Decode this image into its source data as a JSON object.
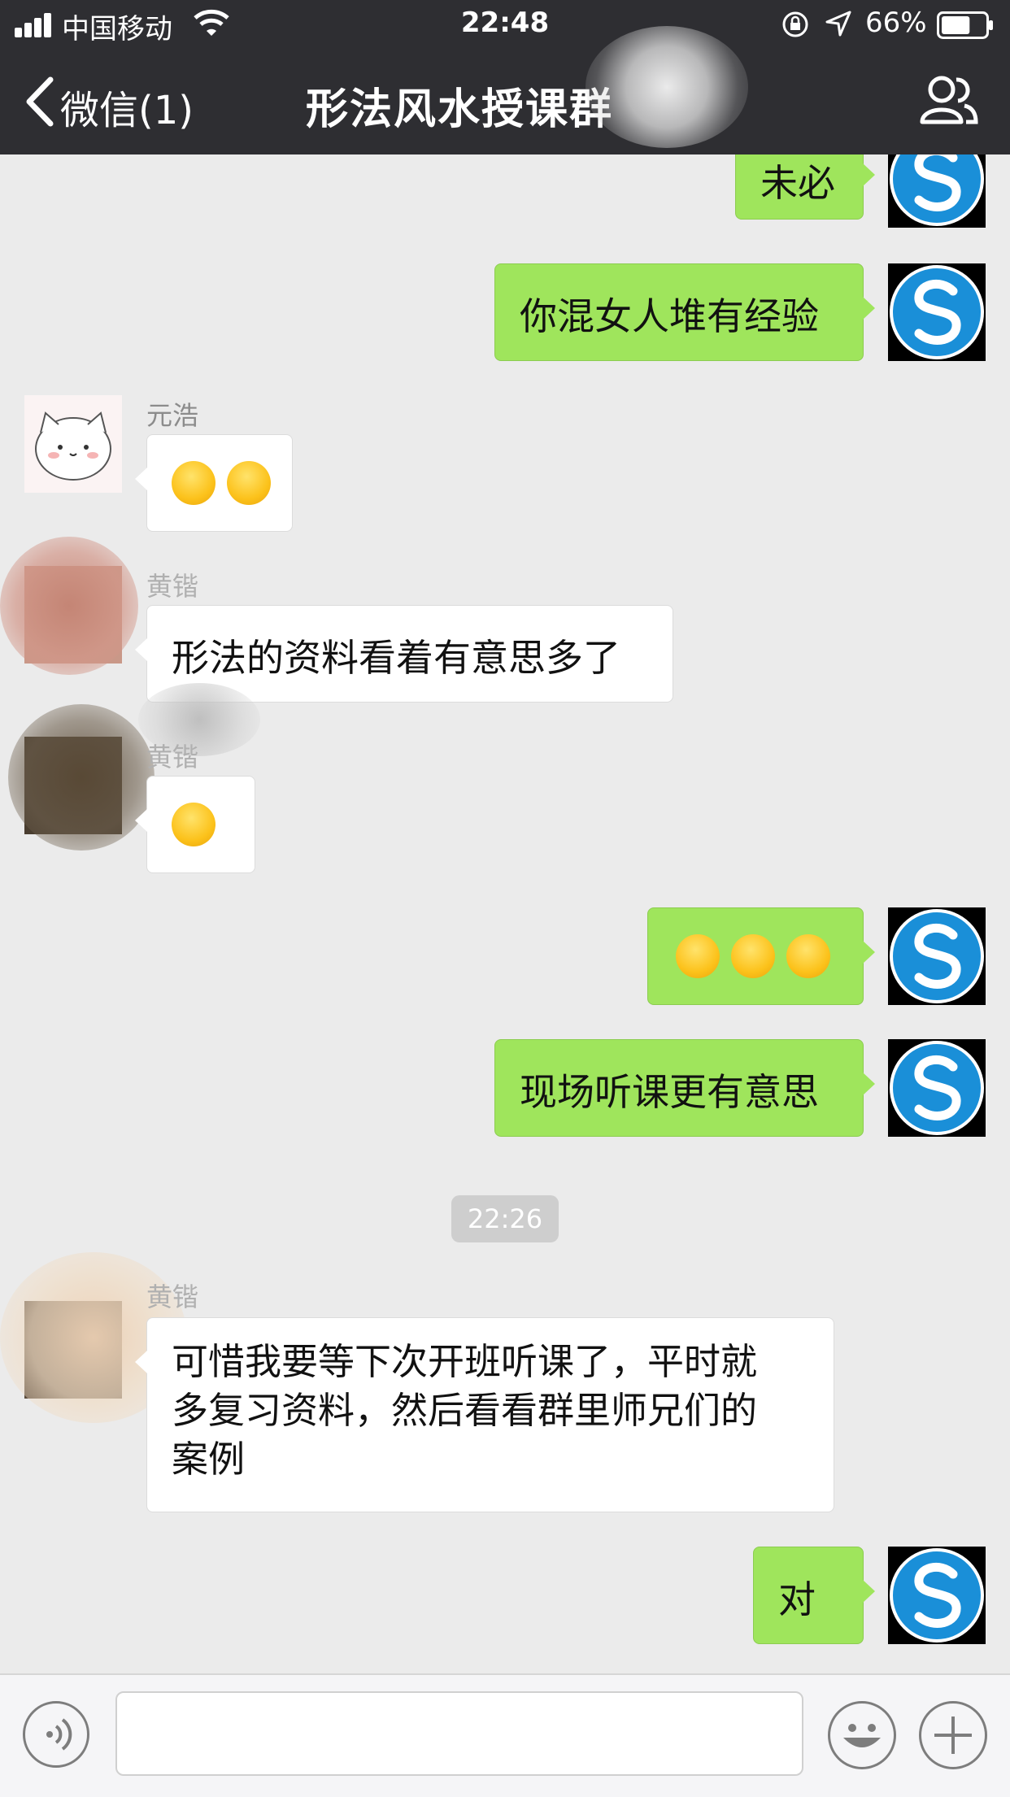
{
  "status_bar": {
    "carrier": "中国移动",
    "time": "22:48",
    "battery_percent": "66%",
    "battery_level": 0.66
  },
  "nav": {
    "back_label": "微信(1)",
    "title": "形法风水授课群"
  },
  "messages": [
    {
      "side": "out",
      "text": "未必"
    },
    {
      "side": "out",
      "text": "你混女人堆有经验"
    },
    {
      "side": "in",
      "sender": "元浩",
      "text": "😭😭"
    },
    {
      "side": "in",
      "sender": "黄锴",
      "text": "形法的资料看着有意思多了"
    },
    {
      "side": "in",
      "sender": "黄锴",
      "text": "🤭"
    },
    {
      "side": "out",
      "text": "😄😄😄"
    },
    {
      "side": "out",
      "text": "现场听课更有意思"
    },
    {
      "type": "timestamp",
      "text": "22:26"
    },
    {
      "side": "in",
      "sender": "黄锴",
      "lines": [
        "可惜我要等下次开班听课了，平时就",
        "多复习资料，然后看看群里师兄们的",
        "案例"
      ]
    },
    {
      "side": "out",
      "text": "对"
    }
  ],
  "input": {
    "placeholder": "",
    "value": ""
  },
  "colors": {
    "nav_bg": "#2e2e32",
    "chat_bg": "#ebebeb",
    "outgoing_bubble": "#9fe55c",
    "incoming_bubble": "#ffffff",
    "timestamp_bg": "#cecece"
  },
  "icons": [
    "signal-icon",
    "wifi-icon",
    "orientation-lock-icon",
    "location-arrow-icon",
    "battery-icon",
    "back-chevron-icon",
    "contacts-icon",
    "voice-icon",
    "emoji-face-icon",
    "plus-icon"
  ]
}
